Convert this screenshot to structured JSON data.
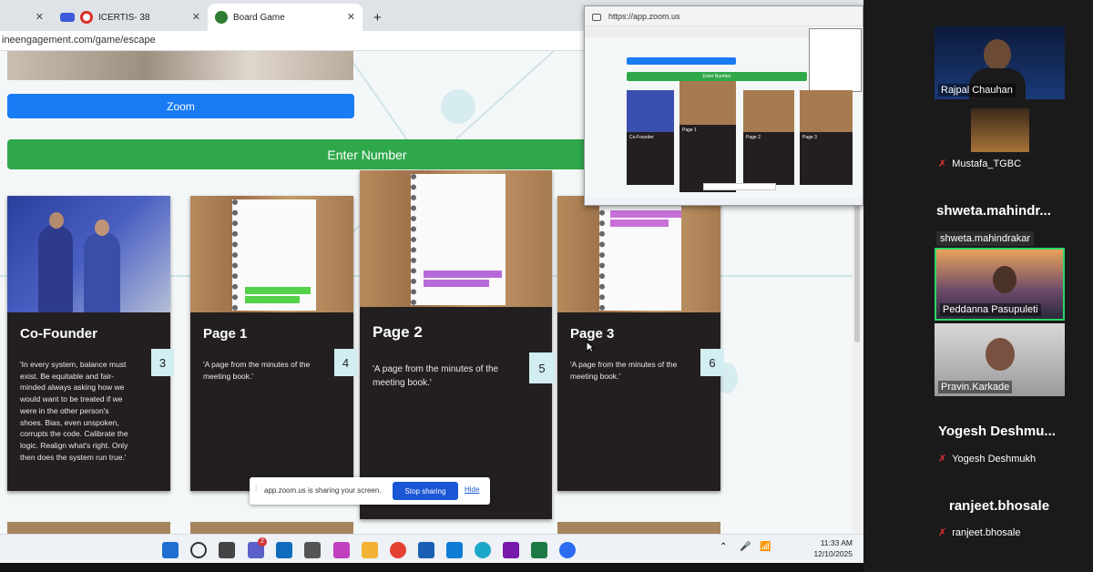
{
  "browser": {
    "tabs": [
      {
        "label": ""
      },
      {
        "label": "ICERTIS- 38"
      },
      {
        "label": "Board Game"
      }
    ],
    "new_tab": "+",
    "close": "✕",
    "address": "ineengagement.com/game/escape"
  },
  "page": {
    "zoom_button": "Zoom",
    "enter_button": "Enter Number",
    "cards": [
      {
        "title": "Co-Founder",
        "text": "'In every system, balance must exist. Be equitable and fair-minded always asking how we would want to be treated if we were in the other person's shoes. Bias, even unspoken, corrupts the code. Calibrate the logic. Realign what's right. Only then does the system run true.'",
        "number": "3"
      },
      {
        "title": "Page 1",
        "text": "'A page from the minutes of the meeting book.'",
        "number": "4"
      },
      {
        "title": "Page 2",
        "text": "'A page from the minutes of the meeting book.'",
        "number": "5"
      },
      {
        "title": "Page 3",
        "text": "'A page from the minutes of the meeting book.'",
        "number": "6"
      }
    ]
  },
  "sharing_bar": {
    "message": "app.zoom.us is sharing your screen.",
    "stop": "Stop sharing",
    "hide": "Hide"
  },
  "mini_window": {
    "url": "https://app.zoom.us",
    "enter_button": "Enter Number",
    "cards": [
      "Co-Founder",
      "Page 1",
      "Page 2",
      "Page 3"
    ]
  },
  "taskbar": {
    "time": "11:33 AM",
    "date": "12/10/2025",
    "badge": "2"
  },
  "participants": [
    {
      "name": "Rajpal Chauhan",
      "kind": "video"
    },
    {
      "name": "Mustafa_TGBC",
      "kind": "muted-thumb"
    },
    {
      "name": "shweta.mahindr...",
      "tag": "shweta.mahindrakar",
      "kind": "name"
    },
    {
      "name": "Peddanna Pasupuleti",
      "kind": "video-active"
    },
    {
      "name": "Pravin.Karkade",
      "kind": "video"
    },
    {
      "name": "Yogesh  Deshmu...",
      "tag": "Yogesh Deshmukh",
      "kind": "name-muted"
    },
    {
      "name": "ranjeet.bhosale",
      "tag": "ranjeet.bhosale",
      "kind": "name-muted"
    }
  ],
  "colors": {
    "zoom": "#1a7cf5",
    "enter": "#2fa84a",
    "card": "#231f20",
    "number_box": "#d2eef2",
    "active_speaker": "#2fd36a"
  }
}
